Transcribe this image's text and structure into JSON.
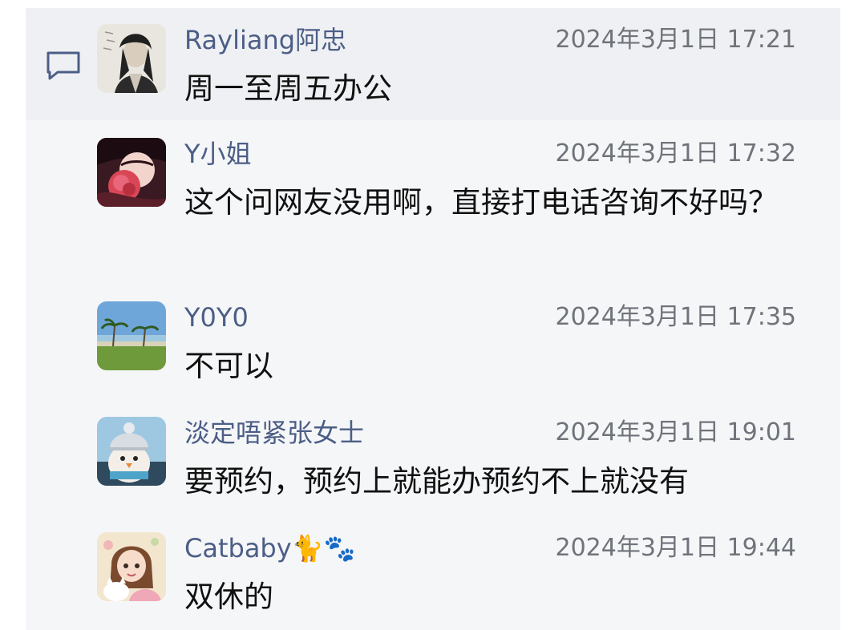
{
  "comments": [
    {
      "username": "Rayliang阿忠",
      "timestamp": "2024年3月1日 17:21",
      "message": "周一至周五办公",
      "avatar_icon": "avatar-ink-painting-man"
    },
    {
      "username": "Y小姐",
      "timestamp": "2024年3月1日 17:32",
      "message": "这个问网友没用啊，直接打电话咨询不好吗？",
      "avatar_icon": "avatar-girl-with-flower"
    },
    {
      "username": "Y0Y0",
      "timestamp": "2024年3月1日 17:35",
      "message": "不可以",
      "avatar_icon": "avatar-beach-palm-trees"
    },
    {
      "username": "淡定唔紧张女士",
      "timestamp": "2024年3月1日 19:01",
      "message": "要预约，预约上就能办预约不上就没有",
      "avatar_icon": "avatar-knit-hat-penguin"
    },
    {
      "username": "Catbaby🐈🐾",
      "timestamp": "2024年3月1日 19:44",
      "message": "双休的",
      "avatar_icon": "avatar-cartoon-girl-cat"
    }
  ],
  "icons": {
    "comment": "comment-bubble-icon"
  },
  "colors": {
    "username": "#4c5e86",
    "timestamp": "#6f737a",
    "message": "#111111",
    "panel_background": "#f5f6f8"
  }
}
